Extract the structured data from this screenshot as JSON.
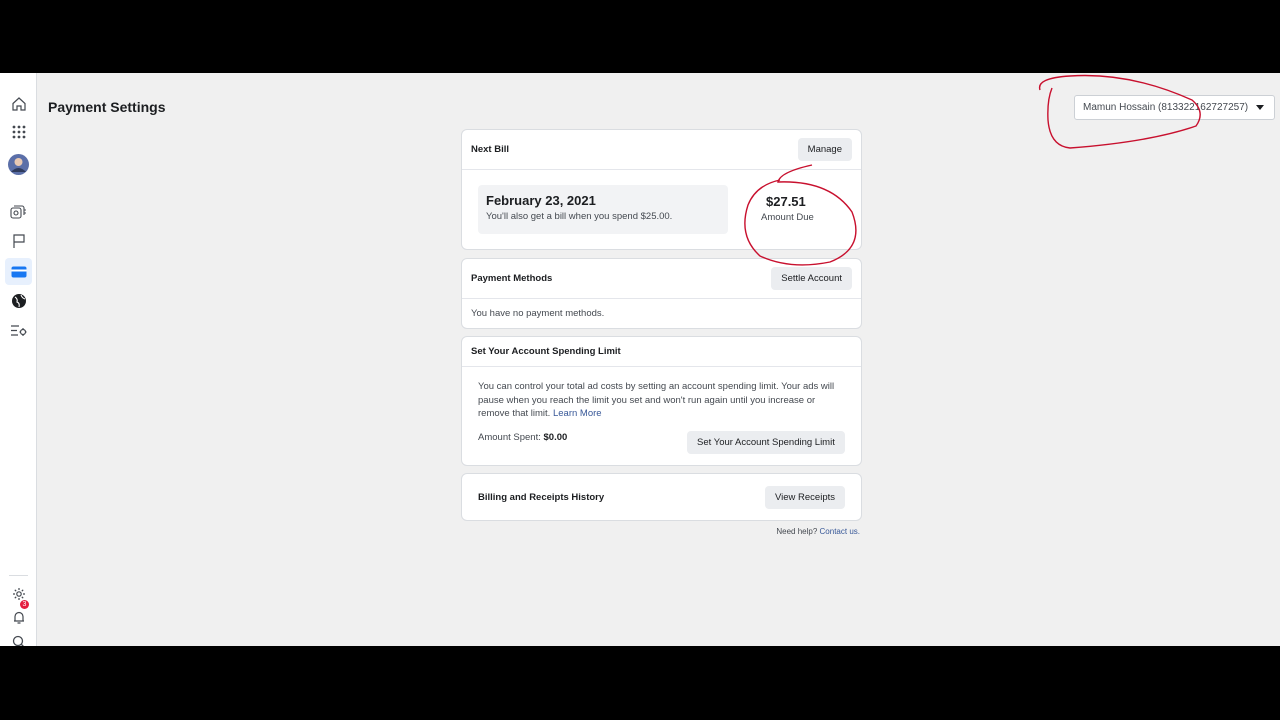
{
  "page": {
    "title": "Payment Settings"
  },
  "account_select": {
    "value": "Mamun Hossain (813322162727257)"
  },
  "rail": {
    "items": [
      "home-icon",
      "apps-grid-icon",
      "avatar",
      "pages-icon",
      "flag-icon",
      "billing-card-icon",
      "globe-icon",
      "settings-list-icon"
    ],
    "bottom": [
      "gear-icon",
      "bell-icon",
      "search-icon"
    ],
    "notification_count": "3"
  },
  "next_bill": {
    "heading": "Next Bill",
    "manage_label": "Manage",
    "date": "February 23, 2021",
    "note": "You'll also get a bill when you spend $25.00.",
    "amount": "$27.51",
    "amount_label": "Amount Due"
  },
  "payment_methods": {
    "heading": "Payment Methods",
    "settle_label": "Settle Account",
    "empty_text": "You have no payment methods."
  },
  "spending_limit": {
    "heading": "Set Your Account Spending Limit",
    "description": "You can control your total ad costs by setting an account spending limit. Your ads will pause when you reach the limit you set and won't run again until you increase or remove that limit.",
    "learn_more": "Learn More",
    "spent_label": "Amount Spent:",
    "spent_value": "$0.00",
    "button_label": "Set Your Account Spending Limit"
  },
  "billing_history": {
    "heading": "Billing and Receipts History",
    "button_label": "View Receipts"
  },
  "help": {
    "text": "Need help?",
    "link": "Contact us."
  },
  "colors": {
    "accent": "#1877f2",
    "annotation": "#c8102e",
    "link": "#385898"
  }
}
